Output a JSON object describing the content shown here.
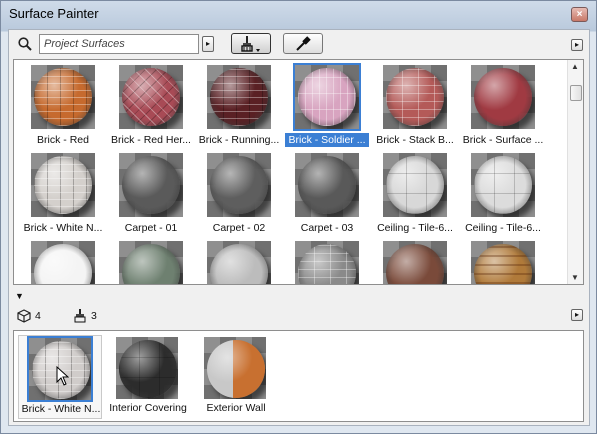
{
  "window": {
    "title": "Surface Painter",
    "close_glyph": "×"
  },
  "toolbar": {
    "search_placeholder": "Project Surfaces",
    "menu_arrow": "▸",
    "paint_tool_icon": "paint-brush-icon",
    "eyedropper_icon": "eyedropper-icon"
  },
  "surfaces": [
    {
      "label": "Brick - Red",
      "color": "#c66a2e",
      "pattern": "brick"
    },
    {
      "label": "Brick - Red Her...",
      "color": "#a84a55",
      "pattern": "herring"
    },
    {
      "label": "Brick - Running...",
      "color": "#5a2024",
      "pattern": "brick"
    },
    {
      "label": "Brick - Soldier ...",
      "color": "#d8a4c0",
      "pattern": "soldier",
      "selected": true
    },
    {
      "label": "Brick - Stack B...",
      "color": "#b45a58",
      "pattern": "stack"
    },
    {
      "label": "Brick - Surface ...",
      "color": "#a03a42",
      "pattern": "plain"
    },
    {
      "label": "Brick - White N...",
      "color": "#d4d0cc",
      "pattern": "brick"
    },
    {
      "label": "Carpet - 01",
      "color": "#5a5a5a",
      "pattern": "plain"
    },
    {
      "label": "Carpet - 02",
      "color": "#5e5e5e",
      "pattern": "plain"
    },
    {
      "label": "Carpet - 03",
      "color": "#595959",
      "pattern": "plain"
    },
    {
      "label": "Ceiling - Tile-6...",
      "color": "#d8d8d8",
      "pattern": "tile"
    },
    {
      "label": "Ceiling - Tile-6...",
      "color": "#dcdcdc",
      "pattern": "tile"
    },
    {
      "label": "",
      "color": "#f4f4f4",
      "pattern": "plain"
    },
    {
      "label": "",
      "color": "#6e8070",
      "pattern": "plain"
    },
    {
      "label": "",
      "color": "#bcbcbc",
      "pattern": "plain"
    },
    {
      "label": "",
      "color": "#8a8a8a",
      "pattern": "stack"
    },
    {
      "label": "",
      "color": "#7a4a3a",
      "pattern": "plain"
    },
    {
      "label": "",
      "color": "#b07a3a",
      "pattern": "wood"
    }
  ],
  "counts": {
    "model_count": "4",
    "painted_count": "3"
  },
  "applied": [
    {
      "label": "Brick - White N...",
      "color": "#d0ccca",
      "pattern": "brick",
      "selected": true
    },
    {
      "label": "Interior Covering",
      "color": "#2c2c2c",
      "pattern": "tile"
    },
    {
      "label": "Exterior Wall",
      "color": "#c87030",
      "pattern": "split"
    }
  ],
  "colors": {
    "accent": "#3b7fd4"
  }
}
